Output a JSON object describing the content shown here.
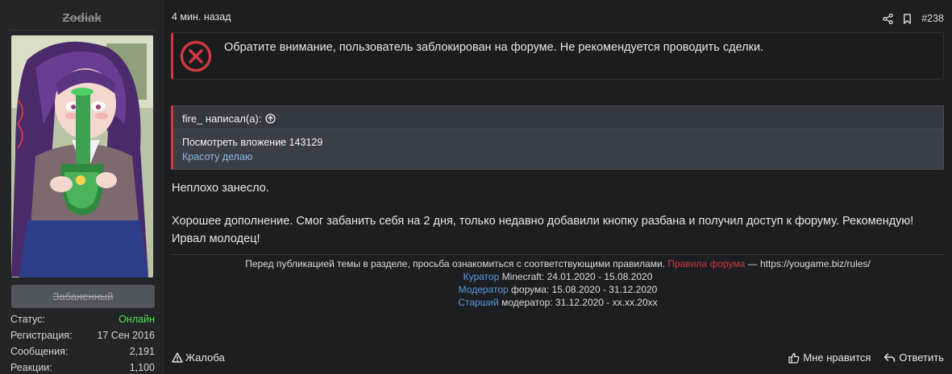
{
  "user": {
    "name": "Zodiak",
    "rank_badge": "Забаненный",
    "stats": [
      {
        "label": "Статус:",
        "value": "Онлайн"
      },
      {
        "label": "Регистрация:",
        "value": "17 Сен 2016"
      },
      {
        "label": "Сообщения:",
        "value": "2,191"
      },
      {
        "label": "Реакции:",
        "value": "1,100"
      }
    ]
  },
  "post": {
    "time": "4 мин. назад",
    "number": "#238",
    "alert": "Обратите внимание, пользователь заблокирован на форуме. Не рекомендуется проводить сделки.",
    "quote": {
      "author": "fire_ написал(а):",
      "line1": "Посмотреть вложение 143129",
      "line2": "Красоту делаю"
    },
    "body": [
      "Неплохо занесло.",
      "Хорошее дополнение. Смог забанить себя на 2 дня, только недавно добавили кнопку разбана и получил доступ к форуму. Рекомендую!",
      "Ирвал молодец!"
    ]
  },
  "signature": {
    "line1_text": "Перед публикацией темы в разделе, просьба ознакомиться с соответствующими правилами.",
    "line1_link": "Правила форума",
    "line1_url": "— https://yougame.biz/rules/",
    "line2_role": "Куратор",
    "line2_rest": "Minecraft: 24.01.2020 - 15.08.2020",
    "line3_role": "Модератор",
    "line3_rest": "форума: 15.08.2020 - 31.12.2020",
    "line4_role": "Старший",
    "line4_rest": "модератор: 31.12.2020 - xx.xx.20xx"
  },
  "footer": {
    "report": "Жалоба",
    "like": "Мне нравится",
    "reply": "Ответить"
  },
  "colors": {
    "accent_red": "#d0383e",
    "link_blue": "#5b9ae0",
    "online_green": "#4ee34e"
  }
}
